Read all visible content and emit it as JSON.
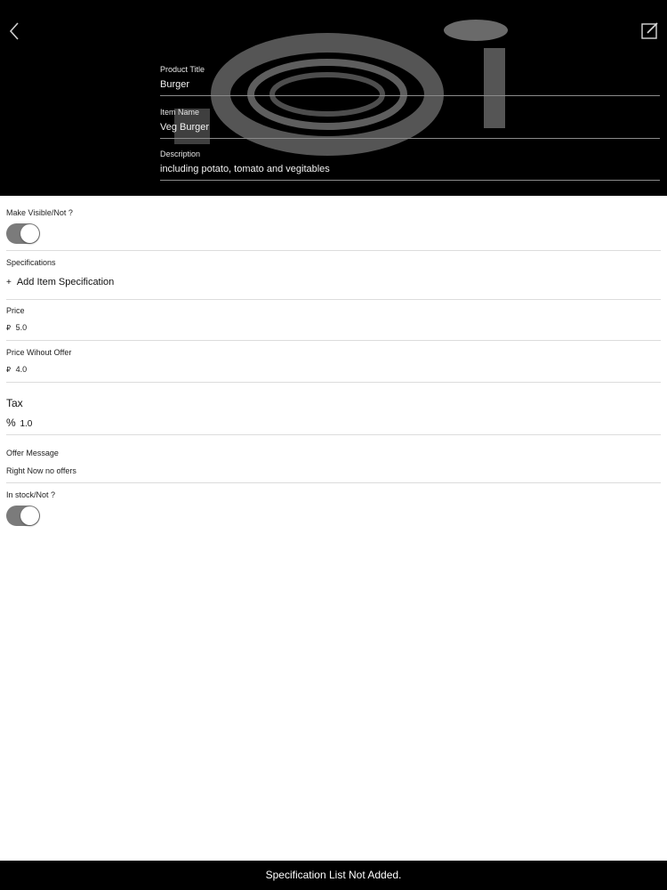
{
  "header": {
    "back_icon": "chevron-left-icon",
    "edit_icon": "edit-icon",
    "fields": [
      {
        "label": "Product Title",
        "value": "Burger"
      },
      {
        "label": "Item Name",
        "value": "Veg Burger"
      },
      {
        "label": "Description",
        "value": "including potato, tomato and vegitables"
      }
    ]
  },
  "visibility": {
    "label": "Make Visible/Not ?",
    "on": true
  },
  "specifications": {
    "label": "Specifications",
    "add_symbol": "+",
    "add_label": "Add Item Specification"
  },
  "price": {
    "label": "Price",
    "currency": "₽",
    "value": "5.0"
  },
  "price_without_offer": {
    "label": "Price Wihout Offer",
    "currency": "₽",
    "value": "4.0"
  },
  "tax": {
    "label": "Tax",
    "symbol": "%",
    "value": "1.0"
  },
  "offer": {
    "label": "Offer Message",
    "value": "Right Now no offers"
  },
  "stock": {
    "label": "In stock/Not ?",
    "on": true
  },
  "toast": {
    "message": "Specification List Not Added."
  },
  "colors": {
    "header_bg": "#000000",
    "toggle_on": "#7b7b7b",
    "divider": "#dcdcdc"
  }
}
